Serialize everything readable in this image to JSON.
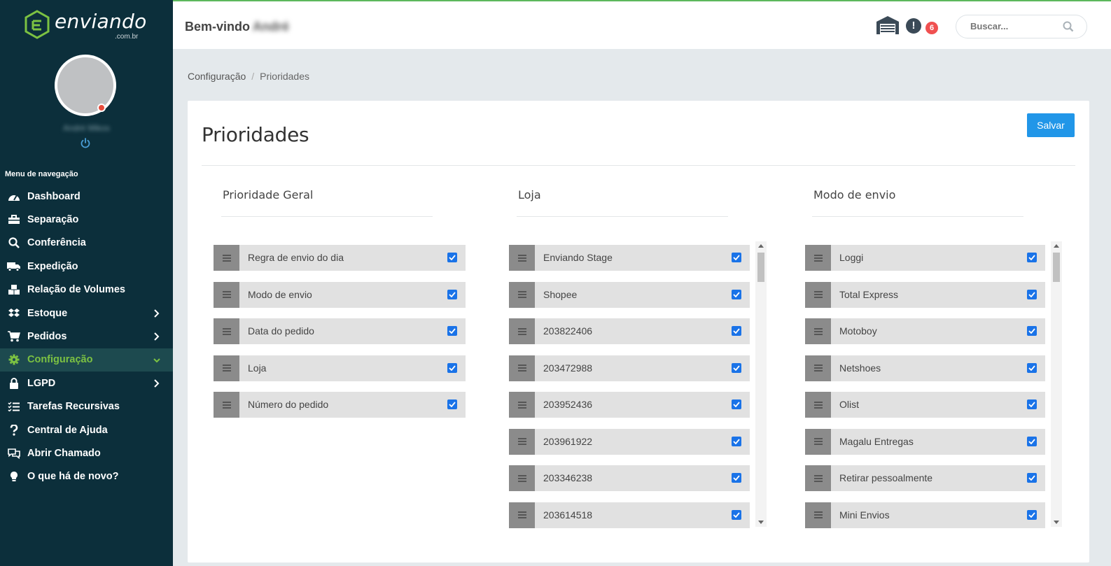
{
  "app": {
    "brand": "enviando",
    "brand_sub": ".com.br"
  },
  "header": {
    "welcome": "Bem-vindo",
    "user_first": "André",
    "alert_count": "6",
    "search_placeholder": "Buscar..."
  },
  "sidebar": {
    "user_name": "André Mikos",
    "nav_title": "Menu de navegação",
    "items": [
      {
        "label": "Dashboard",
        "icon": "speedometer-icon"
      },
      {
        "label": "Separação",
        "icon": "toolbox-icon"
      },
      {
        "label": "Conferência",
        "icon": "search-icon"
      },
      {
        "label": "Expedição",
        "icon": "truck-icon"
      },
      {
        "label": "Relação de Volumes",
        "icon": "boxes-icon"
      },
      {
        "label": "Estoque",
        "icon": "dropbox-icon",
        "chevron": "right"
      },
      {
        "label": "Pedidos",
        "icon": "cart-icon",
        "chevron": "right"
      },
      {
        "label": "Configuração",
        "icon": "gear-icon",
        "chevron": "down",
        "active": true
      },
      {
        "label": "LGPD",
        "icon": "lock-icon",
        "chevron": "right"
      },
      {
        "label": "Tarefas Recursivas",
        "icon": "tasks-icon"
      },
      {
        "label": "Central de Ajuda",
        "icon": "question-icon"
      },
      {
        "label": "Abrir Chamado",
        "icon": "chat-icon"
      },
      {
        "label": "O que há de novo?",
        "icon": "lightbulb-icon"
      }
    ]
  },
  "breadcrumb": {
    "parent": "Configuração",
    "separator": "/",
    "current": "Prioridades"
  },
  "page": {
    "title": "Prioridades",
    "save_label": "Salvar"
  },
  "columns": [
    {
      "heading": "Prioridade Geral",
      "items": [
        "Regra de envio do dia",
        "Modo de envio",
        "Data do pedido",
        "Loja",
        "Número do pedido"
      ]
    },
    {
      "heading": "Loja",
      "items": [
        "Enviando Stage",
        "Shopee",
        "203822406",
        "203472988",
        "203952436",
        "203961922",
        "203346238",
        "203614518"
      ]
    },
    {
      "heading": "Modo de envio",
      "items": [
        "Loggi",
        "Total Express",
        "Motoboy",
        "Netshoes",
        "Olist",
        "Magalu Entregas",
        "Retirar pessoalmente",
        "Mini Envios"
      ]
    }
  ],
  "colors": {
    "sidebar_bg": "#0c2f3b",
    "accent_green": "#7cc242",
    "primary_blue": "#2196e8",
    "badge_red": "#f05050"
  }
}
